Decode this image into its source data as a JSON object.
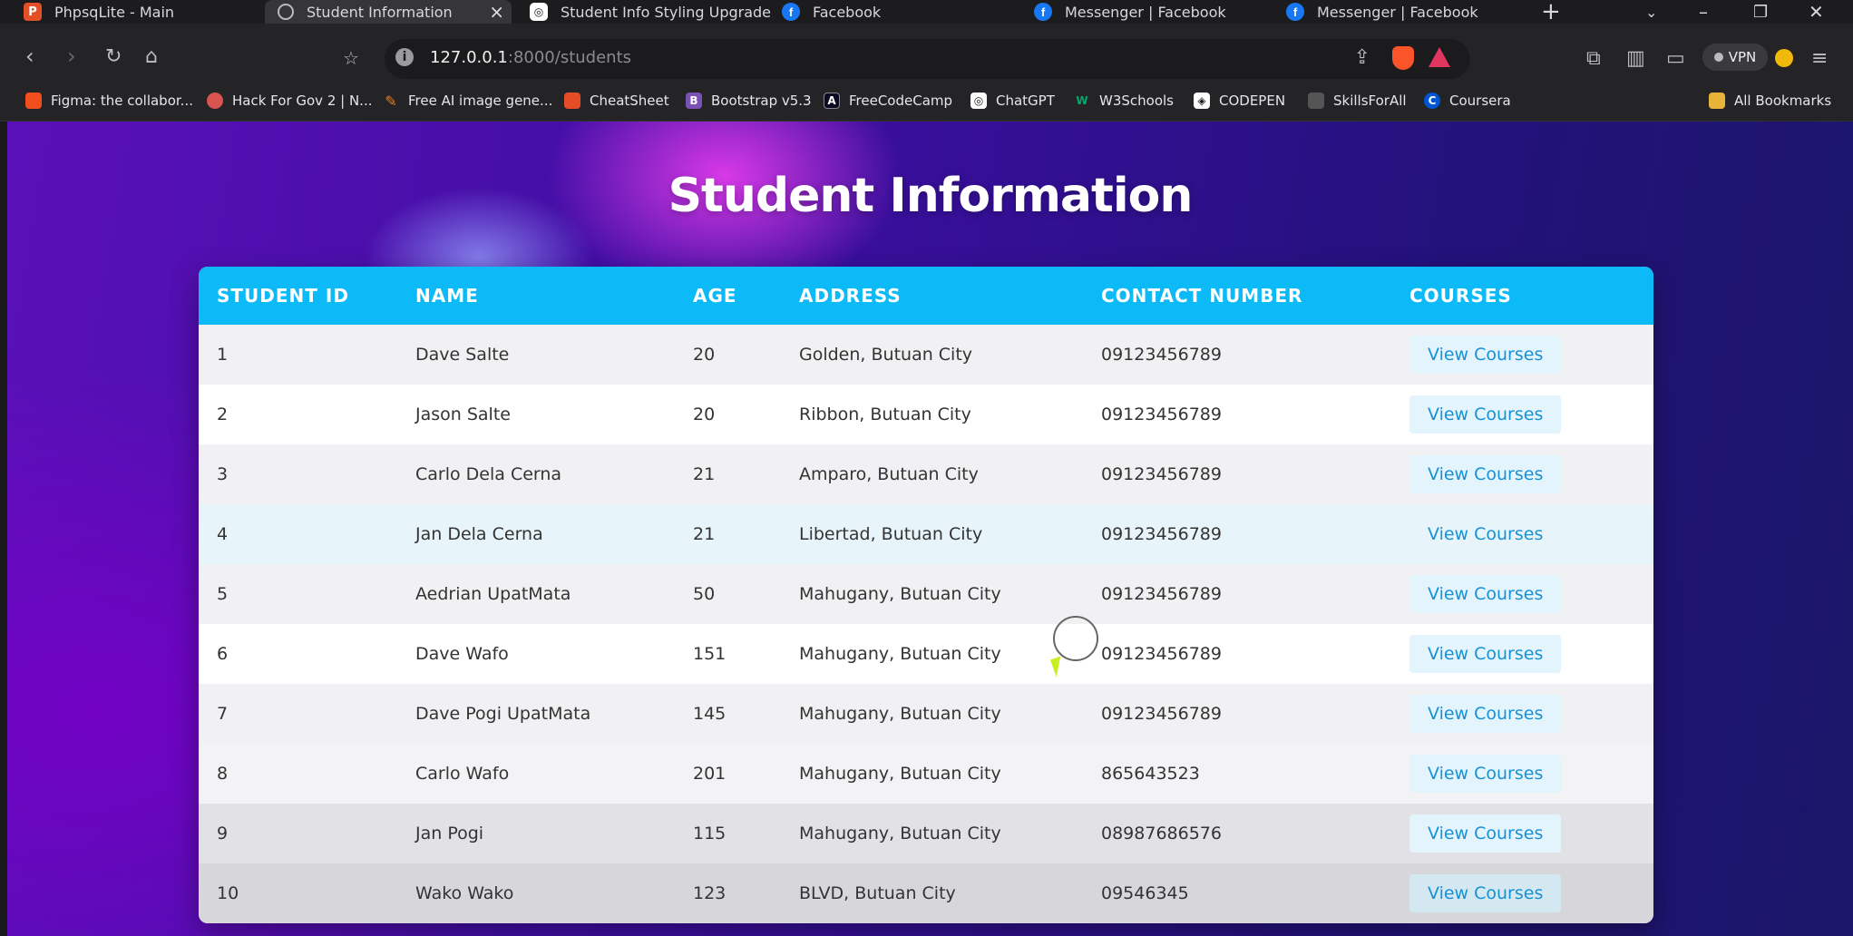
{
  "browser": {
    "tabs": [
      {
        "label": "PhpsqLite - Main",
        "icon": "phpmyadmin-icon"
      },
      {
        "label": "Student Information",
        "icon": "globe-icon",
        "active": true
      },
      {
        "label": "Student Info Styling Upgrade",
        "icon": "chatgpt-icon"
      },
      {
        "label": "Facebook",
        "icon": "facebook-icon"
      },
      {
        "label": "Messenger | Facebook",
        "icon": "facebook-icon"
      },
      {
        "label": "Messenger | Facebook",
        "icon": "facebook-icon"
      }
    ],
    "url_host": "127.0.0.1",
    "url_rest": ":8000/students",
    "vpn_label": "VPN",
    "bookmarks": [
      {
        "label": "Figma: the collabor...",
        "color": "#f24e1e"
      },
      {
        "label": "Hack For Gov 2 | N...",
        "color": "#d9534f"
      },
      {
        "label": "Free AI image gene...",
        "color": "#e67e22"
      },
      {
        "label": "CheatSheet",
        "color": "#e44d26"
      },
      {
        "label": "Bootstrap v5.3",
        "color": "#7952b3"
      },
      {
        "label": "FreeCodeCamp",
        "color": "#0a0a23"
      },
      {
        "label": "ChatGPT",
        "color": "#ffffff"
      },
      {
        "label": "W3Schools",
        "color": "#04aa6d"
      },
      {
        "label": "CODEPEN",
        "color": "#ffffff"
      },
      {
        "label": "SkillsForAll",
        "color": "#555555"
      },
      {
        "label": "Coursera",
        "color": "#0056d2"
      }
    ],
    "all_bookmarks": "All Bookmarks"
  },
  "page": {
    "title": "Student Information",
    "columns": [
      "STUDENT ID",
      "NAME",
      "AGE",
      "ADDRESS",
      "CONTACT NUMBER",
      "COURSES"
    ],
    "action_label": "View Courses",
    "rows": [
      {
        "id": "1",
        "name": "Dave Salte",
        "age": "20",
        "address": "Golden, Butuan City",
        "contact": "09123456789"
      },
      {
        "id": "2",
        "name": "Jason Salte",
        "age": "20",
        "address": "Ribbon, Butuan City",
        "contact": "09123456789"
      },
      {
        "id": "3",
        "name": "Carlo Dela Cerna",
        "age": "21",
        "address": "Amparo, Butuan City",
        "contact": "09123456789"
      },
      {
        "id": "4",
        "name": "Jan Dela Cerna",
        "age": "21",
        "address": "Libertad, Butuan City",
        "contact": "09123456789"
      },
      {
        "id": "5",
        "name": "Aedrian UpatMata",
        "age": "50",
        "address": "Mahugany, Butuan City",
        "contact": "09123456789"
      },
      {
        "id": "6",
        "name": "Dave Wafo",
        "age": "151",
        "address": "Mahugany, Butuan City",
        "contact": "09123456789"
      },
      {
        "id": "7",
        "name": "Dave Pogi UpatMata",
        "age": "145",
        "address": "Mahugany, Butuan City",
        "contact": "09123456789"
      },
      {
        "id": "8",
        "name": "Carlo Wafo",
        "age": "201",
        "address": "Mahugany, Butuan City",
        "contact": "865643523"
      },
      {
        "id": "9",
        "name": "Jan Pogi",
        "age": "115",
        "address": "Mahugany, Butuan City",
        "contact": "08987686576"
      },
      {
        "id": "10",
        "name": "Wako Wako",
        "age": "123",
        "address": "BLVD, Butuan City",
        "contact": "09546345"
      }
    ]
  },
  "colors": {
    "header": "#0dbaf8",
    "button_text": "#1592d6",
    "button_bg": "#e4f4fd"
  }
}
